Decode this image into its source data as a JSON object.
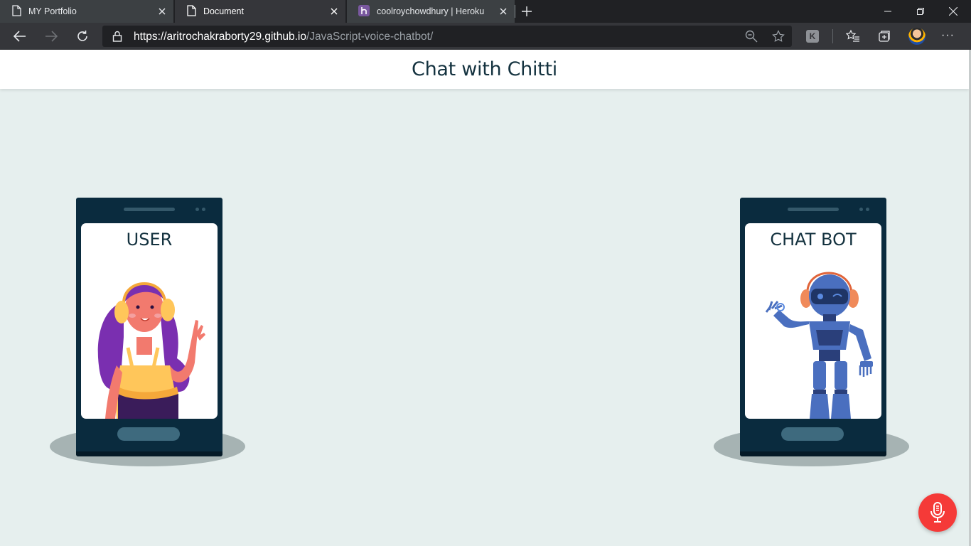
{
  "browser": {
    "tabs": [
      {
        "title": "MY Portfolio",
        "icon": "page-icon",
        "active": false
      },
      {
        "title": "Document",
        "icon": "page-icon",
        "active": true
      },
      {
        "title": "coolroychowdhury | Heroku",
        "icon": "heroku-icon",
        "active": false
      }
    ],
    "address": {
      "host": "https://aritrochakraborty29.github.io",
      "path": "/JavaScript-voice-chatbot/"
    },
    "extension_letter": "K",
    "more_label": "···"
  },
  "page": {
    "title": "Chat with Chitti",
    "user_phone": {
      "label": "USER"
    },
    "bot_phone": {
      "label": "CHAT BOT"
    },
    "mic_button": {
      "icon": "microphone-icon",
      "color": "#f53a38"
    }
  },
  "colors": {
    "header_text": "#14323f",
    "page_background": "#e6efee",
    "phone_body": "#0a2b3e",
    "mic_accent": "#f53a38"
  }
}
